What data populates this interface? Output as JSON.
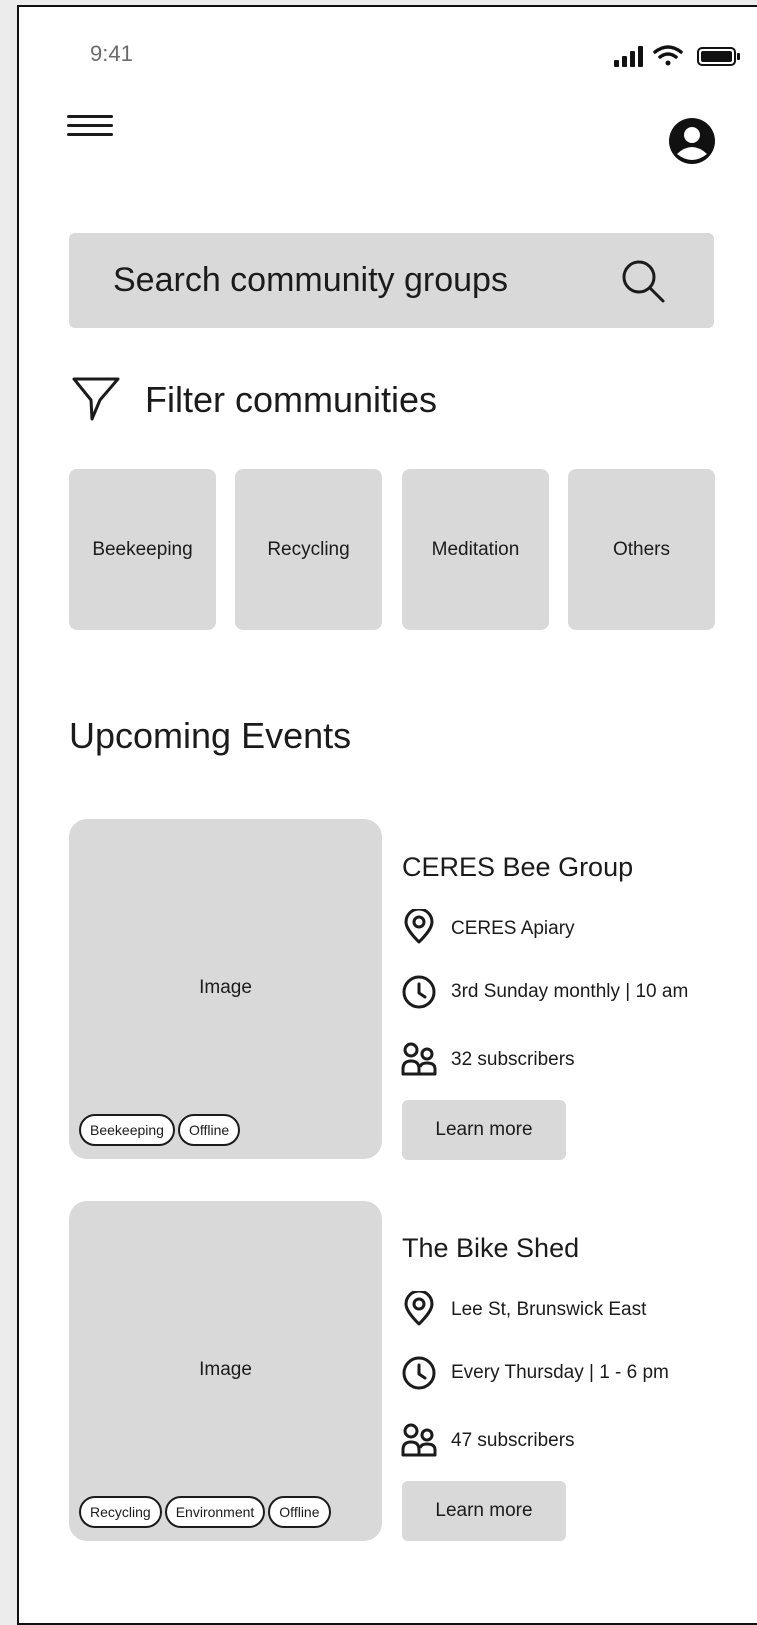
{
  "status_bar": {
    "time": "9:41"
  },
  "search": {
    "placeholder": "Search community groups"
  },
  "filter": {
    "title": "Filter communities",
    "categories": [
      "Beekeeping",
      "Recycling",
      "Meditation",
      "Others"
    ]
  },
  "upcoming": {
    "title": "Upcoming Events",
    "events": [
      {
        "image_label": "Image",
        "tags": [
          "Beekeeping",
          "Offline"
        ],
        "title": "CERES Bee Group",
        "location": "CERES Apiary",
        "schedule": "3rd Sunday monthly | 10 am",
        "subscribers": "32 subscribers",
        "button": "Learn more"
      },
      {
        "image_label": "Image",
        "tags": [
          "Recycling",
          "Environment",
          "Offline"
        ],
        "title": "The Bike Shed",
        "location": "Lee St, Brunswick East",
        "schedule": "Every Thursday | 1 - 6 pm",
        "subscribers": "47 subscribers",
        "button": "Learn more"
      }
    ]
  }
}
